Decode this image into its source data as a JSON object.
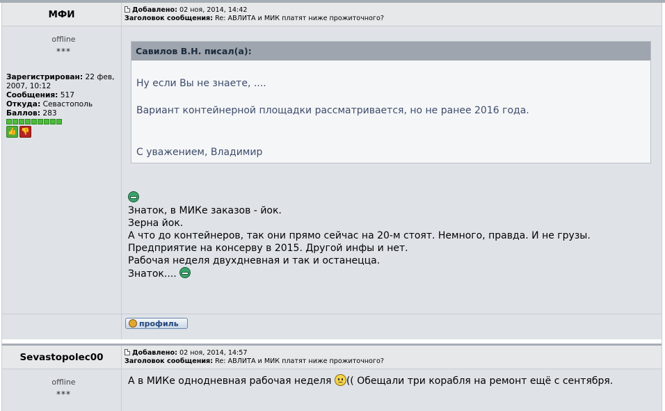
{
  "posts": [
    {
      "author": "МФИ",
      "added_label": "Добавлено:",
      "added_date": "02 ноя, 2014, 14:42",
      "subject_label": "Заголовок сообщения:",
      "subject": "Re: АВЛИТА и МИК платят ниже прожиточного?",
      "status": "offline",
      "stars": "***",
      "registered_label": "Зарегистрирован:",
      "registered": "22 фев, 2007, 10:12",
      "messages_label": "Сообщения:",
      "messages": "517",
      "from_label": "Откуда:",
      "from": "Севастополь",
      "points_label": "Баллов:",
      "points": "283",
      "reputation_level": 9,
      "quote": {
        "header": "Савилов В.Н. писал(а):",
        "lines": [
          "Ну если Вы не знаете, ....",
          "Вариант контейнерной площадки рассматривается, но не ранее 2016 года.",
          "С уважением, Владимир"
        ]
      },
      "lines": [
        "Знаток, в МИКе заказов - йок.",
        "Зерна йок.",
        "А что до контейнеров, так они прямо сейчас на 20-м стоят. Немного, правда. И не грузы.",
        "Предприятие на консерву в 2015. Другой инфы и нет.",
        "Рабочая неделя двухдневная и так и останецца.",
        "Знаток...."
      ],
      "profile_button": "профиль"
    },
    {
      "author": "Sevastopolec00",
      "added_label": "Добавлено:",
      "added_date": "02 ноя, 2014, 14:57",
      "subject_label": "Заголовок сообщения:",
      "subject": "Re: АВЛИТА и МИК платят ниже прожиточного?",
      "status": "offline",
      "stars": "***",
      "text_before": "А в МИКе однодневная рабочая неделя ",
      "text_after": "(( Обещали три корабля на ремонт ещё с сентября."
    }
  ]
}
